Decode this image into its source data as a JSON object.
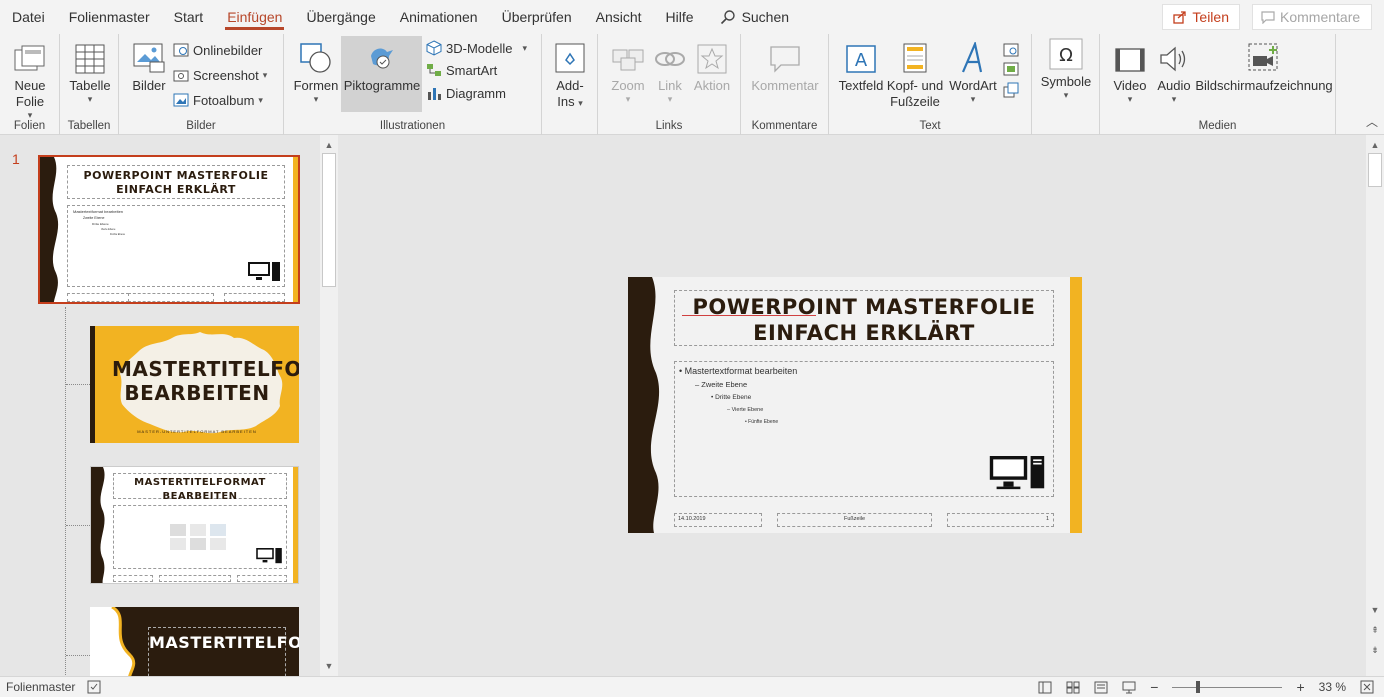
{
  "menu": {
    "items": [
      "Datei",
      "Folienmaster",
      "Start",
      "Einfügen",
      "Übergänge",
      "Animationen",
      "Überprüfen",
      "Ansicht",
      "Hilfe"
    ],
    "active_index": 3,
    "search_label": "Suchen",
    "share_label": "Teilen",
    "comments_label": "Kommentare"
  },
  "ribbon": {
    "folien": {
      "label": "Folien",
      "new_slide": "Neue",
      "new_slide2": "Folie"
    },
    "tabellen": {
      "label": "Tabellen",
      "table": "Tabelle"
    },
    "bilder": {
      "label": "Bilder",
      "pictures": "Bilder",
      "online": "Onlinebilder",
      "screenshot": "Screenshot",
      "album": "Fotoalbum"
    },
    "illustrationen": {
      "label": "Illustrationen",
      "shapes": "Formen",
      "icons": "Piktogramme",
      "models": "3D-Modelle",
      "smartart": "SmartArt",
      "chart": "Diagramm"
    },
    "addins": {
      "label1": "Add-",
      "label2": "Ins"
    },
    "links": {
      "label": "Links",
      "zoom": "Zoom",
      "link": "Link",
      "action": "Aktion"
    },
    "kommentare": {
      "label": "Kommentare",
      "comment": "Kommentar"
    },
    "text": {
      "label": "Text",
      "textbox": "Textfeld",
      "header1": "Kopf- und",
      "header2": "Fußzeile",
      "wordart": "WordArt"
    },
    "symbole": {
      "label": "Symbole"
    },
    "medien": {
      "label": "Medien",
      "video": "Video",
      "audio": "Audio",
      "screenrec": "Bildschirmaufzeichnung"
    }
  },
  "thumbnails": {
    "slide_number": "1",
    "master_title": "POWERPOINT MASTERFOLIE EINFACH ERKLÄRT",
    "layout1_title": "MASTERTITELFORMAT BEARBEITEN",
    "layout1_sub": "MASTER-UNTERTITELFORMAT BEARBEITEN",
    "layout2_title": "MASTERTITELFORMAT BEARBEITEN",
    "layout3_title": "MASTERTITELFORMAT"
  },
  "slide": {
    "title": "POWERPOINT MASTERFOLIE EINFACH ERKLÄRT",
    "level1": "Mastertextformat bearbeiten",
    "level2": "Zweite Ebene",
    "level3": "Dritte Ebene",
    "level4": "Vierte Ebene",
    "level5": "Fünfte Ebene",
    "date": "14.10.2019",
    "footer": "Fußzeile",
    "page": "1"
  },
  "status": {
    "view_label": "Folienmaster",
    "zoom": "33 %"
  },
  "colors": {
    "accent": "#c43e1c",
    "dark_brown": "#2b1c0e",
    "gold": "#f2b322"
  }
}
